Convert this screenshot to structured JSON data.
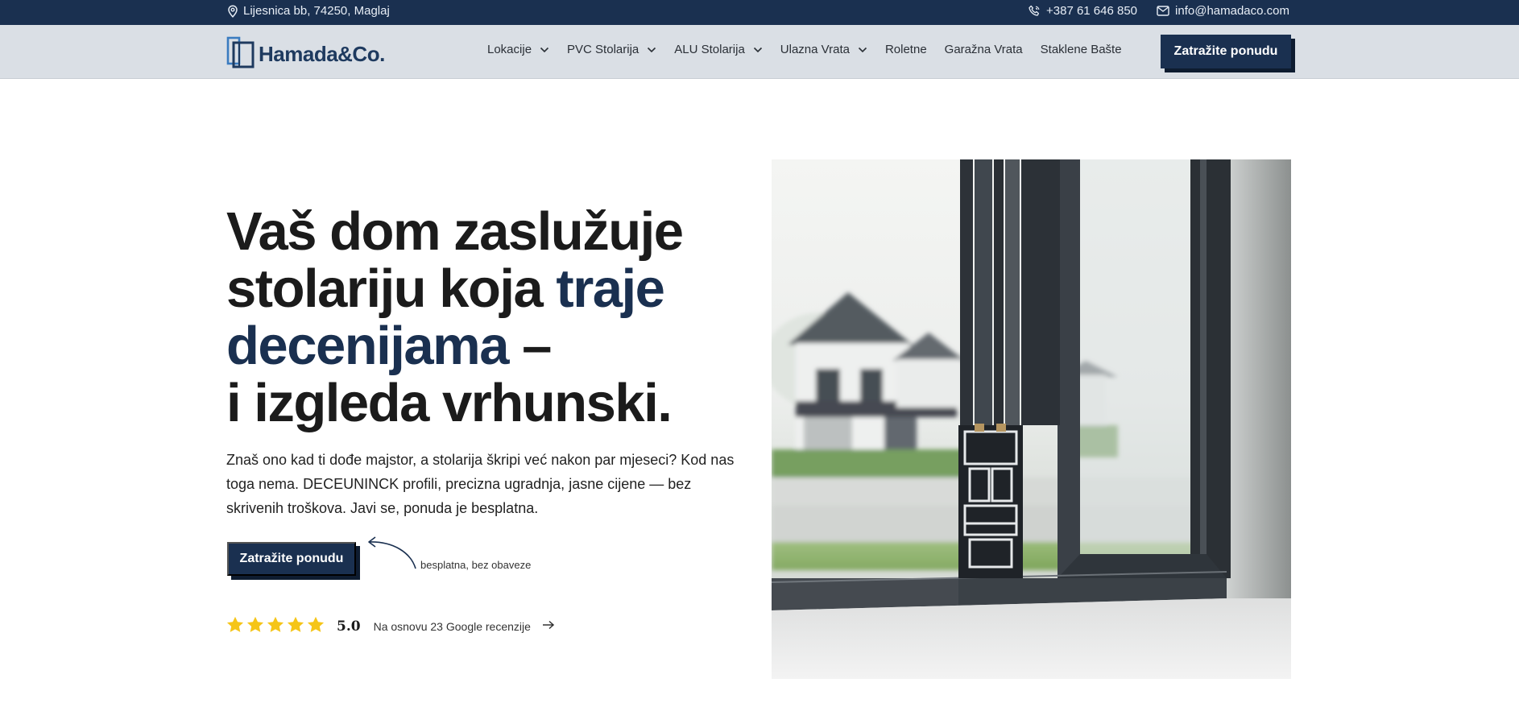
{
  "topbar": {
    "address": "Lijesnica bb, 74250, Maglaj",
    "phone": "+387 61 646 850",
    "email": "info@hamadaco.com",
    "icons": [
      "location-pin-icon",
      "phone-icon",
      "mail-icon"
    ]
  },
  "brand": {
    "name": "Hamada&Co."
  },
  "nav": {
    "items": [
      {
        "label": "Lokacije",
        "dropdown": true
      },
      {
        "label": "PVC Stolarija",
        "dropdown": true
      },
      {
        "label": "ALU Stolarija",
        "dropdown": true
      },
      {
        "label": "Ulazna Vrata",
        "dropdown": true
      },
      {
        "label": "Roletne",
        "dropdown": false
      },
      {
        "label": "Garažna Vrata",
        "dropdown": false
      },
      {
        "label": "Staklene Bašte",
        "dropdown": false
      }
    ],
    "cta": "Zatražite ponudu"
  },
  "hero": {
    "title_line1": "Vaš dom zaslužuje",
    "title_line2a": "stolariju koja ",
    "title_line2b": "traje",
    "title_line3a": "decenijama",
    "title_line3b": " –",
    "title_line4": "i izgleda vrhunski.",
    "description": "Znaš ono kad ti dođe majstor, a stolarija škripi već nakon par mjeseci? Kod nas toga nema. DECEUNINCK profili, precizna ugradnja, jasne cijene — bez skrivenih troškova. Javi se, ponuda je besplatna.",
    "cta": "Zatražite ponudu",
    "cta_note": "besplatna, bez obaveze",
    "rating": {
      "stars": 5,
      "score": "5.0",
      "text": "Na osnovu 23 Google recenzije"
    }
  },
  "colors": {
    "navy": "#1a3050",
    "nav_bg": "#dadfe5",
    "star": "#f5c518"
  }
}
